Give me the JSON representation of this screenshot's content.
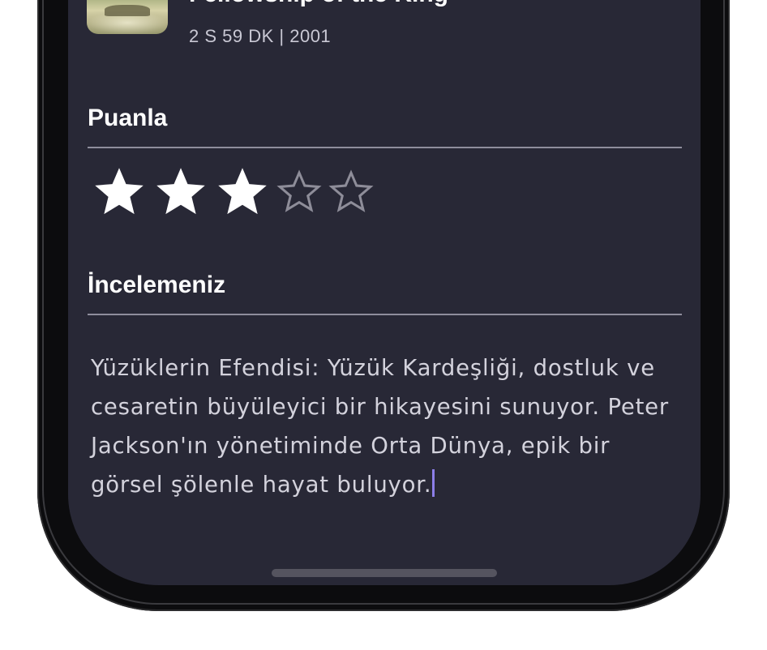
{
  "movie": {
    "title": "Fellowship of the King",
    "meta": "2 S 59 DK | 2001"
  },
  "rating": {
    "label": "Puanla",
    "value": 3,
    "max": 5
  },
  "review": {
    "label": "İncelemeniz",
    "text": "Yüzüklerin Efendisi: Yüzük Kardeşliği, dostluk ve cesaretin büyüleyici bir hikayesini sunuyor. Peter Jackson'ın yönetiminde Orta Dünya, epik bir görsel şölenle hayat buluyor."
  },
  "colors": {
    "screen_background": "#282836",
    "star_filled": "#ffffff",
    "star_empty": "#8e8d99",
    "caret": "#8c7ee8"
  },
  "icons": {
    "star_filled": "star-filled-icon",
    "star_empty": "star-outline-icon"
  }
}
